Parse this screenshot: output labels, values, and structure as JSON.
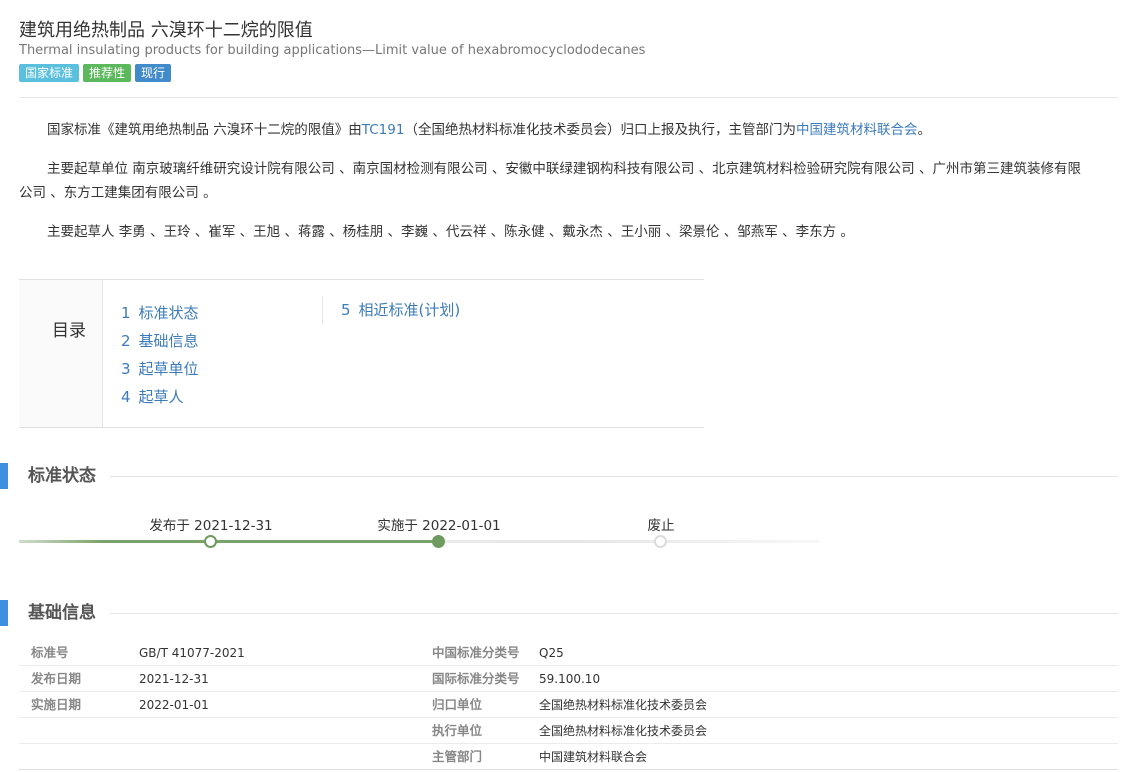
{
  "header": {
    "title": "建筑用绝热制品 六溴环十二烷的限值",
    "subtitle": "Thermal insulating products for building applications—Limit value of hexabromocyclododecanes",
    "tags": [
      "国家标准",
      "推荐性",
      "现行"
    ]
  },
  "description": {
    "p1_before": "国家标准《建筑用绝热制品 六溴环十二烷的限值》由",
    "p1_link1": "TC191",
    "p1_middle": "（全国绝热材料标准化技术委员会）归口上报及执行，主管部门为",
    "p1_link2": "中国建筑材料联合会",
    "p1_after": "。",
    "p2_line1": "主要起草单位 南京玻璃纤维研究设计院有限公司 、南京国材检测有限公司 、安徽中联绿建钢构科技有限公司 、北京建筑材料检验研究院有限公司 、广州市第三建筑装修有限",
    "p2_line2": "公司 、东方工建集团有限公司 。",
    "p3": "主要起草人 李勇 、王玲 、崔军 、王旭 、蒋露 、杨桂朋 、李巍 、代云祥 、陈永健 、戴永杰 、王小丽 、梁景伦 、邹燕军 、李东方 。"
  },
  "toc": {
    "title": "目录",
    "items": [
      {
        "num": "1",
        "label": "标准状态"
      },
      {
        "num": "2",
        "label": "基础信息"
      },
      {
        "num": "3",
        "label": "起草单位"
      },
      {
        "num": "4",
        "label": "起草人"
      },
      {
        "num": "5",
        "label": "相近标准(计划)"
      }
    ]
  },
  "status": {
    "section_title": "标准状态",
    "steps": [
      {
        "label": "发布于 2021-12-31",
        "state": "done"
      },
      {
        "label": "实施于 2022-01-01",
        "state": "current"
      },
      {
        "label": "废止",
        "state": "pending"
      }
    ],
    "colors": {
      "done": "#6f9a5f",
      "pending": "#dcdcdc"
    }
  },
  "basic_info": {
    "section_title": "基础信息",
    "left": [
      {
        "label": "标准号",
        "value": "GB/T 41077-2021"
      },
      {
        "label": "发布日期",
        "value": "2021-12-31"
      },
      {
        "label": "实施日期",
        "value": "2022-01-01"
      }
    ],
    "right": [
      {
        "label": "中国标准分类号",
        "value": "Q25",
        "link": false
      },
      {
        "label": "国际标准分类号",
        "value": "59.100.10",
        "link": false
      },
      {
        "label": "归口单位",
        "value": "全国绝热材料标准化技术委员会",
        "link": true
      },
      {
        "label": "执行单位",
        "value": "全国绝热材料标准化技术委员会",
        "link": true
      },
      {
        "label": "主管部门",
        "value": "中国建筑材料联合会",
        "link": true
      }
    ]
  },
  "colors": {
    "link": "#3c7bb9",
    "section_bar": "#3d8fe0",
    "tag_national": "#5bc0de",
    "tag_recommended": "#5cb85c",
    "tag_current": "#428bca"
  }
}
